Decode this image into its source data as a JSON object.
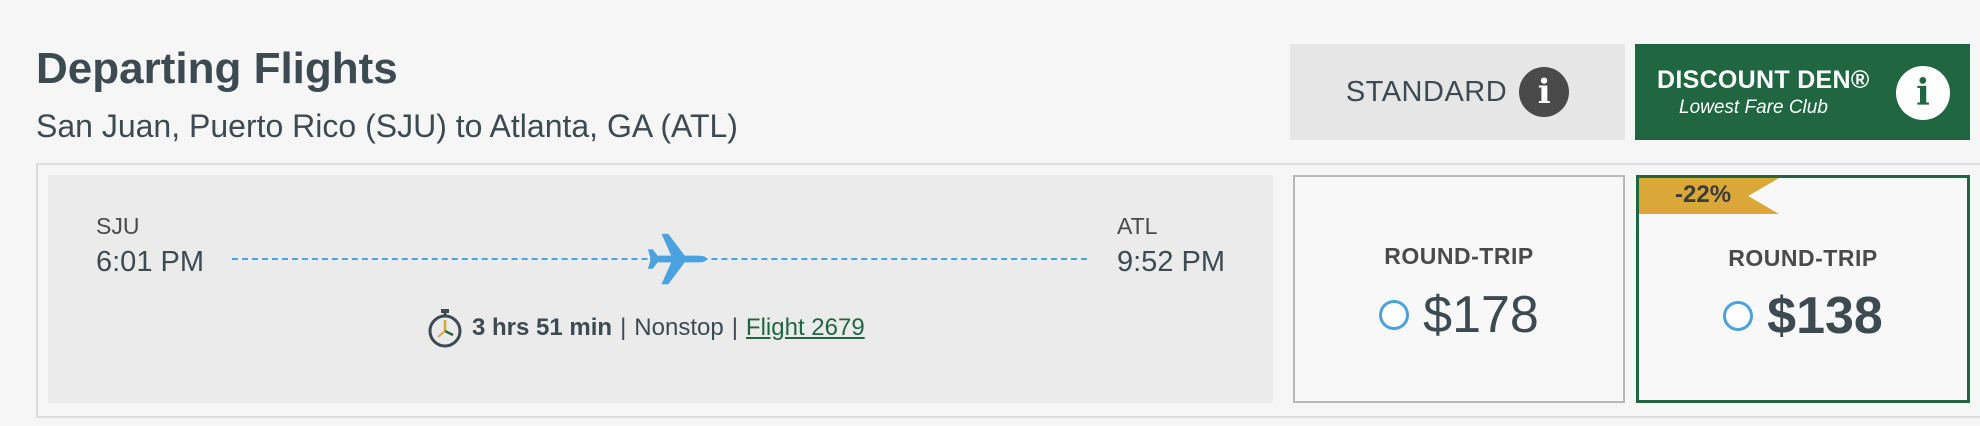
{
  "header": {
    "title": "Departing Flights",
    "subtitle": "San Juan, Puerto Rico (SJU) to Atlanta, GA (ATL)"
  },
  "tabs": {
    "standard": {
      "label": "STANDARD",
      "info_icon": "info-icon"
    },
    "discount": {
      "name": "DISCOUNT DEN®",
      "sub": "Lowest Fare Club",
      "info_icon": "info-icon"
    }
  },
  "flight": {
    "origin": {
      "code": "SJU",
      "time": "6:01 PM"
    },
    "destination": {
      "code": "ATL",
      "time": "9:52 PM"
    },
    "plane_icon": "airplane-icon",
    "duration": "3 hrs 51 min",
    "stops": "Nonstop",
    "separator": "|",
    "flight_link": "Flight 2679"
  },
  "fares": {
    "standard": {
      "type": "ROUND-TRIP",
      "price": "$178"
    },
    "discount": {
      "type": "ROUND-TRIP",
      "price": "$138",
      "badge": "-22%"
    }
  },
  "colors": {
    "brand_green": "#1f6641",
    "accent_blue": "#4aa3df",
    "badge_gold": "#d9a838",
    "text_dark": "#3c4a52"
  }
}
